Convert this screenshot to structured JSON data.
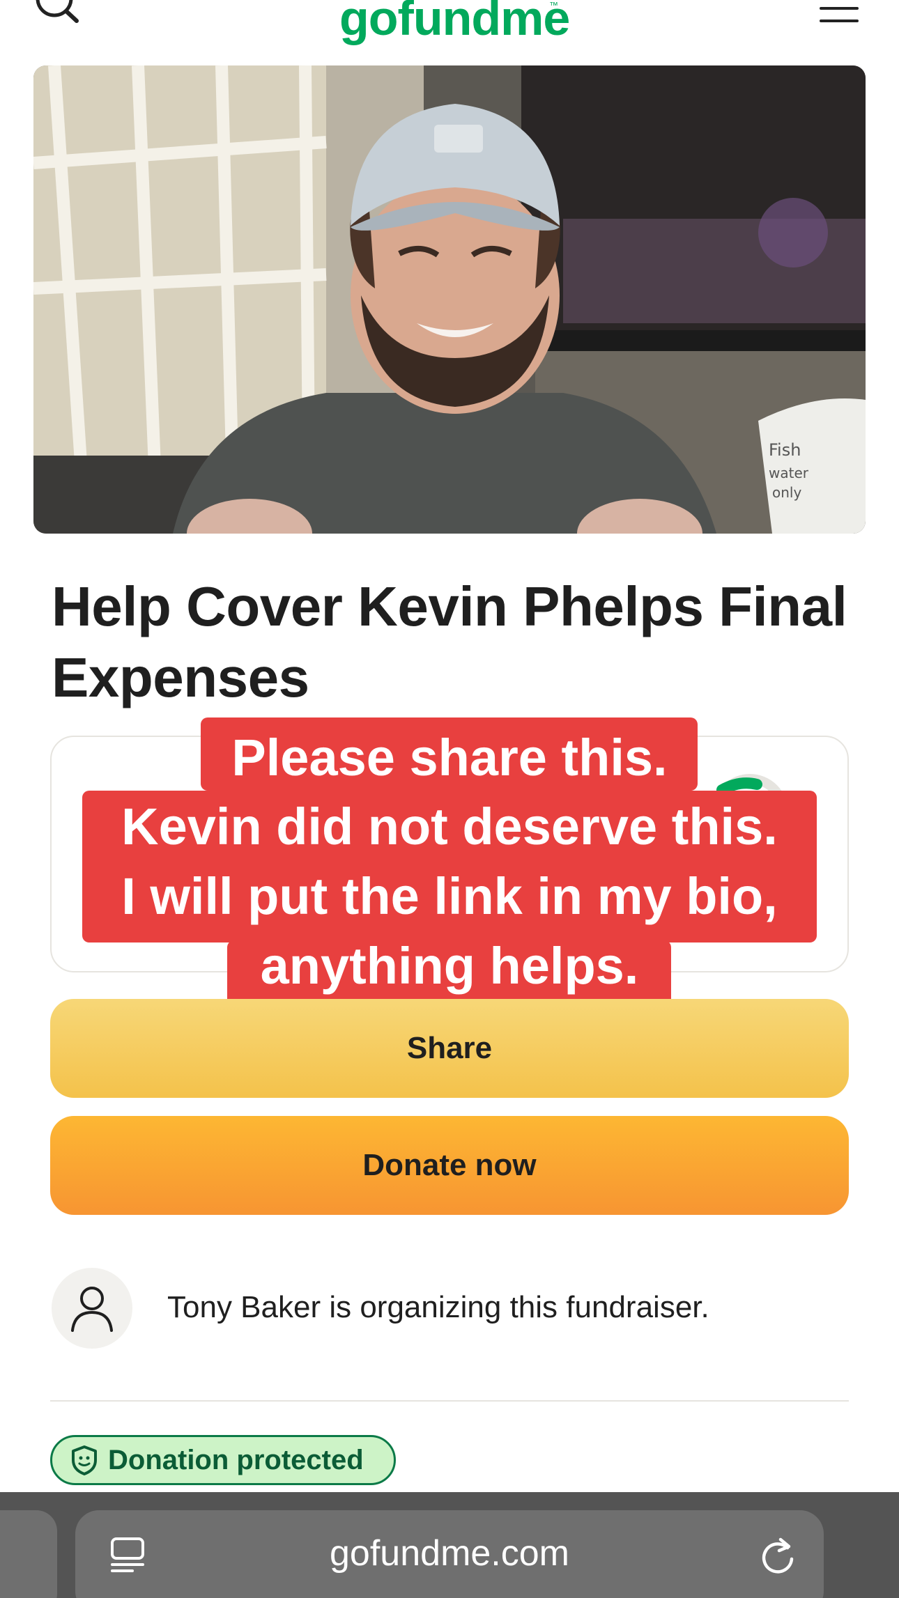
{
  "header": {
    "logo_text": "gofundme",
    "logo_trademark": "™",
    "logo_color": "#02a95c",
    "icons": [
      "search-icon",
      "menu-icon"
    ]
  },
  "hero": {
    "visible_text": [
      "Fish",
      "water",
      "only"
    ]
  },
  "campaign": {
    "title": "Help Cover Kevin Phelps Final Expenses"
  },
  "caption_overlay": {
    "lines": [
      "Please share this.",
      "Kevin did not deserve this.",
      "I will put the link in my bio,",
      "anything helps."
    ],
    "background_color": "#e8403f"
  },
  "buttons": {
    "share_label": "Share",
    "donate_label": "Donate now"
  },
  "organizer": {
    "text": "Tony Baker is organizing this fundraiser.",
    "avatar_icon": "person-icon"
  },
  "badge": {
    "label": "Donation protected",
    "icon": "shield-icon"
  },
  "browser": {
    "url": "gofundme.com",
    "icons": [
      "reader-mode-icon",
      "reload-icon"
    ]
  }
}
